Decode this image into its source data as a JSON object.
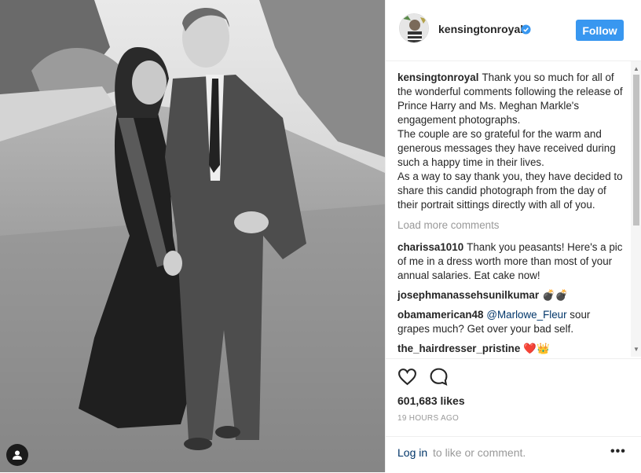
{
  "post": {
    "image_alt_icon": "person-tag-icon"
  },
  "header": {
    "username": "kensingtonroyal",
    "verified_icon": "verified-badge-icon",
    "follow_label": "Follow"
  },
  "caption": {
    "username": "kensingtonroyal",
    "text": "Thank you so much for all of the wonderful comments following the release of Prince Harry and Ms. Meghan Markle's engagement photographs.\nThe couple are so grateful for the warm and generous messages they have received during such a happy time in their lives.\nAs a way to say thank you, they have decided to share this candid photograph from the day of their portrait sittings directly with all of you."
  },
  "load_more_label": "Load more comments",
  "comments": [
    {
      "username": "charissa1010",
      "text": "Thank you peasants! Here's a pic of me in a dress worth more than most of your annual salaries. Eat cake now!"
    },
    {
      "username": "josephmanassehsunilkumar",
      "text": "💣💣"
    },
    {
      "username": "obamamerican48",
      "mention": "@Marlowe_Fleur",
      "text": " sour grapes much? Get over your bad self."
    },
    {
      "username": "the_hairdresser_pristine",
      "text": "❤️👑"
    }
  ],
  "actions": {
    "like_icon": "heart-icon",
    "comment_icon": "comment-icon",
    "likes": "601,683 likes",
    "timestamp": "19 HOURS AGO"
  },
  "footer": {
    "login_link": "Log in",
    "login_rest": "to like or comment.",
    "more_icon": "more-options-icon",
    "more_label": "•••"
  }
}
